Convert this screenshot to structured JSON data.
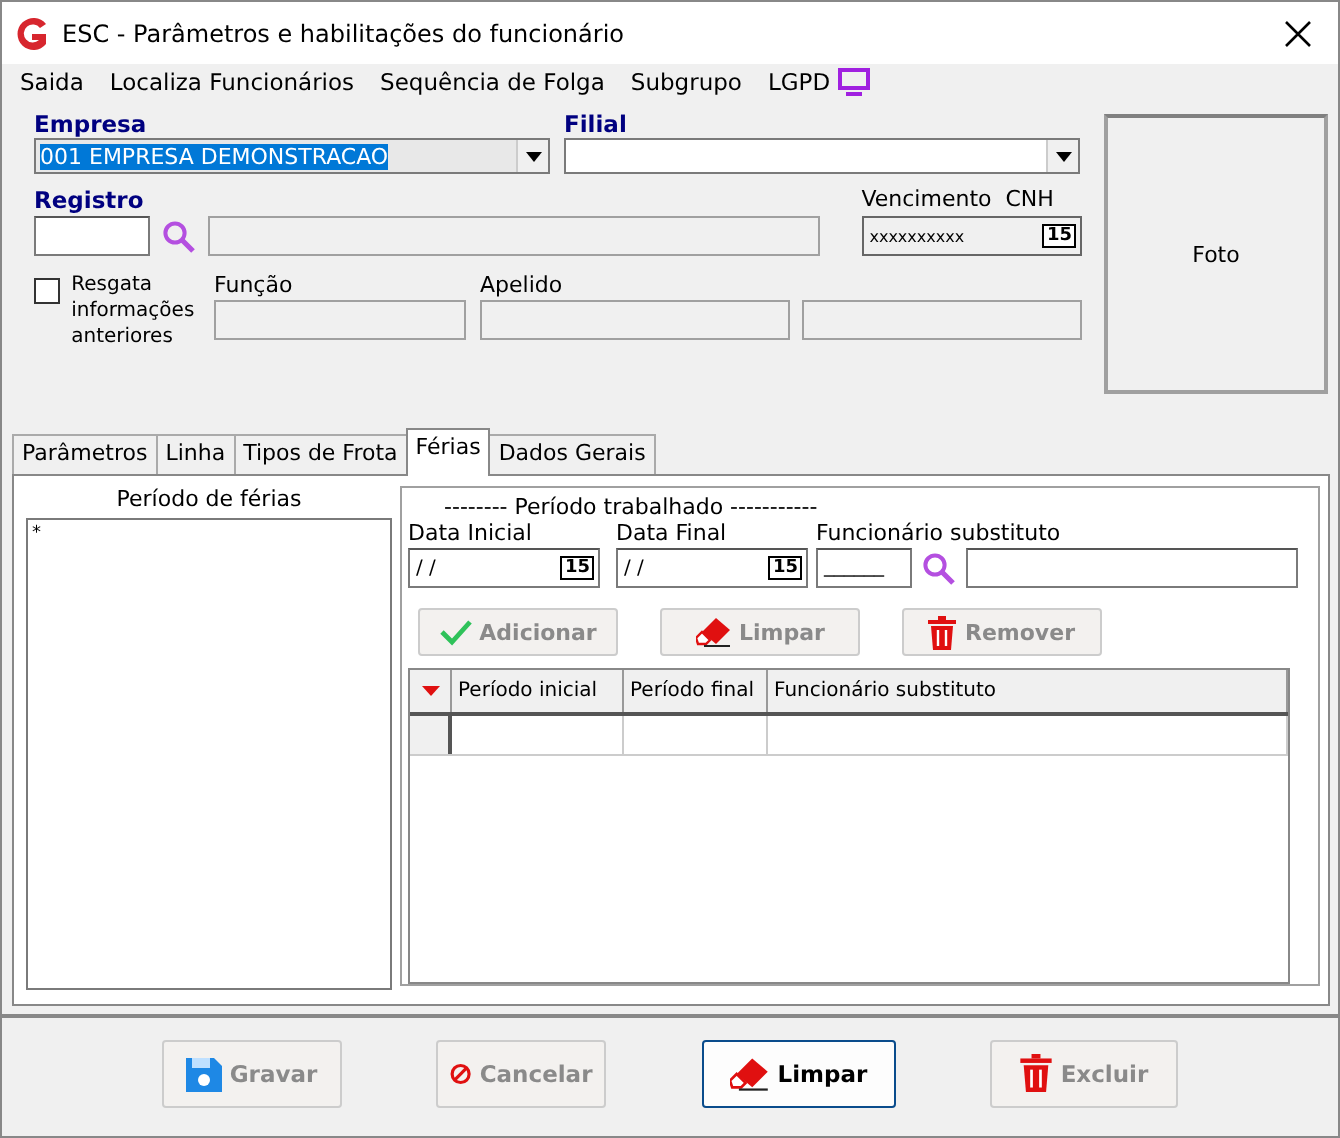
{
  "window": {
    "title": "ESC - Parâmetros e habilitações do funcionário"
  },
  "menu": [
    {
      "label": "Saida"
    },
    {
      "label": "Localiza Funcionários"
    },
    {
      "label": "Sequência de Folga"
    },
    {
      "label": "Subgrupo"
    },
    {
      "label": "LGPD"
    }
  ],
  "empresa": {
    "label": "Empresa",
    "value": "001 EMPRESA DEMONSTRACAO",
    "text_selected": true
  },
  "filial": {
    "label": "Filial"
  },
  "registro": {
    "label": "Registro"
  },
  "vencimento_cnh": {
    "label": "Vencimento  CNH",
    "value": "xxxxxxxxxx",
    "calendar": "15"
  },
  "resgata": {
    "label": "Resgata informações anteriores",
    "checked": false
  },
  "funcao": {
    "label": "Função"
  },
  "apelido": {
    "label": "Apelido"
  },
  "photo": {
    "label": "Foto"
  },
  "tabs": [
    {
      "label": "Parâmetros",
      "selected": false
    },
    {
      "label": "Linha",
      "selected": false
    },
    {
      "label": "Tipos de Frota",
      "selected": false
    },
    {
      "label": "Férias",
      "selected": true
    },
    {
      "label": "Dados Gerais",
      "selected": false
    }
  ],
  "ferias": {
    "list_title": "Período de férias",
    "list_items": [
      "*"
    ],
    "group_title": "-------- Período trabalhado -----------",
    "data_inicial": {
      "label": "Data Inicial",
      "value": "/ /",
      "calendar": "15"
    },
    "data_final": {
      "label": "Data Final",
      "value": "/ /",
      "calendar": "15"
    },
    "substituto": {
      "label": "Funcionário substituto",
      "code": "______"
    },
    "buttons": [
      {
        "kind": "check",
        "label": "Adicionar",
        "disabled": true
      },
      {
        "kind": "eraser",
        "label": "Limpar",
        "disabled": true
      },
      {
        "kind": "trash",
        "label": "Remover",
        "disabled": true
      }
    ],
    "columns": [
      "Período inicial",
      "Período final",
      "Funcionário substituto"
    ]
  },
  "footer_buttons": [
    {
      "kind": "save",
      "label": "Gravar",
      "disabled": true
    },
    {
      "kind": "cancel",
      "label": "Cancelar",
      "disabled": true
    },
    {
      "kind": "eraser",
      "label": "Limpar",
      "disabled": false
    },
    {
      "kind": "trash",
      "label": "Excluir",
      "disabled": true
    }
  ]
}
